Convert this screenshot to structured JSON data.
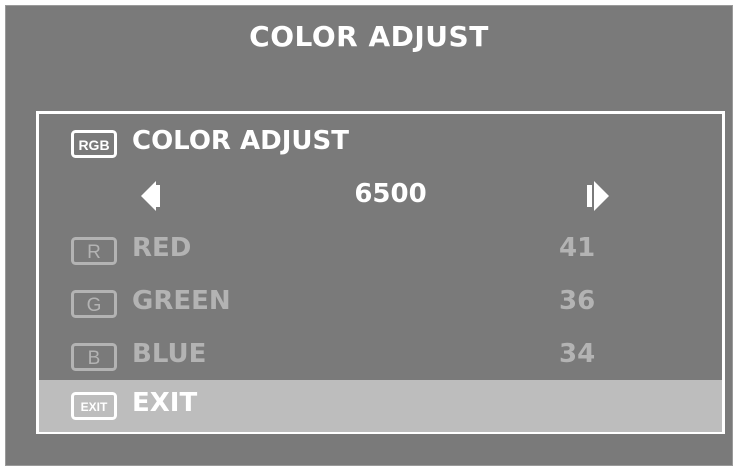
{
  "window": {
    "title": "COLOR ADJUST"
  },
  "menu": {
    "header": {
      "icon_text": "RGB",
      "icon": "rgb-icon",
      "label": "COLOR ADJUST"
    },
    "color_temp": {
      "value": "6500",
      "prev_icon": "triangle-left-icon",
      "next_icon": "triangle-right-icon"
    },
    "items": [
      {
        "icon_text": "R",
        "icon": "red-channel-icon",
        "label": "RED",
        "value": "41"
      },
      {
        "icon_text": "G",
        "icon": "green-channel-icon",
        "label": "GREEN",
        "value": "36"
      },
      {
        "icon_text": "B",
        "icon": "blue-channel-icon",
        "label": "BLUE",
        "value": "34"
      }
    ],
    "exit": {
      "icon_text": "EXIT",
      "icon": "exit-icon",
      "label": "EXIT"
    }
  },
  "colors": {
    "osd_background": "#7a7a7a",
    "active_text": "#ffffff",
    "dim_text": "#b3b3b3",
    "exit_highlight": "#bdbdbd"
  }
}
